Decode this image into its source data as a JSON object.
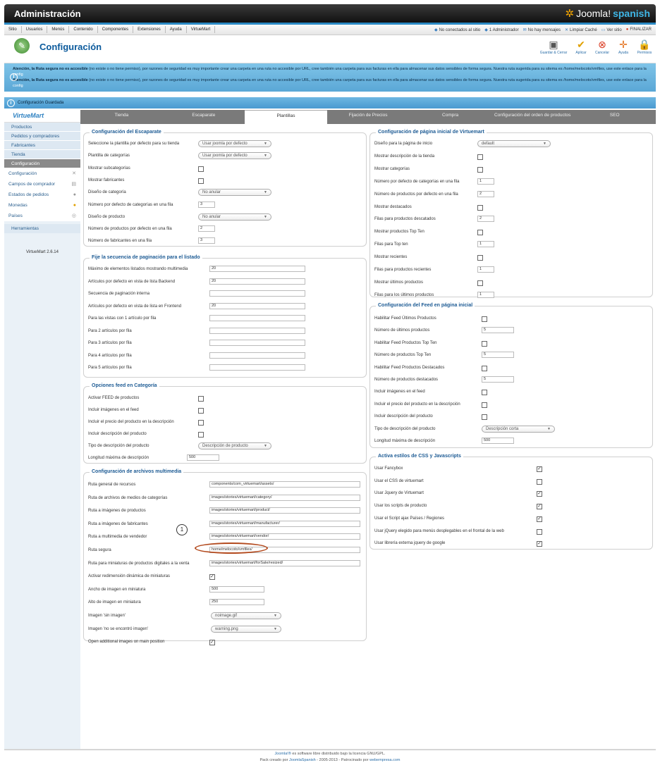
{
  "app": {
    "title": "Administración",
    "logo_word": "Joomla!",
    "logo_suffix": "spanish"
  },
  "menu": {
    "items": [
      "Sitio",
      "Usuarios",
      "Menús",
      "Contenido",
      "Componentes",
      "Extensiones",
      "Ayuda",
      "VirtueMart"
    ],
    "right": [
      "No conectados al sitio",
      "1 Administrador",
      "No hay mensajes",
      "Limpiar Caché",
      "Ver sitio",
      "FINALIZAR"
    ]
  },
  "header": {
    "title": "Configuración"
  },
  "toolbar": {
    "save_close": "Guardar & Cerrar",
    "apply": "Aplicar",
    "cancel": "Cancelar",
    "help": "Ayuda",
    "permissions": "Permisos"
  },
  "alert": {
    "bold_prefix": "Atención, la Ruta segura no ",
    "bold_word": "es accesible",
    "rest": " (no existe o no tiene permiso), por razones de seguridad es muy importante crear una carpeta en una ruta no accesible por URL, cree también una carpeta para sus facturas en ella para almacenar sus datos sensibles de forma segura. Nuestra ruta sugerida para su sitema es /home/melocoto/vmfiles, use este enlace para la ",
    "link": "config"
  },
  "message": {
    "text": "Configuración Guardada"
  },
  "sidebar": {
    "logo": "VirtueMart",
    "items": [
      "Productos",
      "Pedidos y compradores",
      "Fabricantes",
      "Tienda",
      "Configuración"
    ],
    "subitems": [
      "Configuración",
      "Campos de comprador",
      "Estados de pedidos",
      "Monedas",
      "Países"
    ],
    "tools": "Herramientas",
    "version": "VirtueMart 2.6.14"
  },
  "tabs": [
    "Tienda",
    "Escaparate",
    "Plantillas",
    "Fijación de Precios",
    "Compra",
    "Configuración del orden de productos",
    "SEO"
  ],
  "escaparate": {
    "legend": "Configuración del Escaparate",
    "rows": [
      {
        "label": "Seleccione la plantilla por defecto para su tienda",
        "select": "Usar joomla por defecto"
      },
      {
        "label": "Plantilla de categorías",
        "select": "Usar joomla por defecto"
      },
      {
        "label": "Mostrar subcategorías",
        "check": ""
      },
      {
        "label": "Mostrar fabricantes",
        "check": ""
      },
      {
        "label": "Diseño de categoría",
        "select": "No anular"
      },
      {
        "label": "Número por defecto de categorías en una fila",
        "input": "3"
      },
      {
        "label": "Diseño de producto",
        "select": "No anular"
      },
      {
        "label": "Número de productos por defecto en una fila",
        "input": "2"
      },
      {
        "label": "Número de fabricantes en una fila",
        "input": "3"
      }
    ]
  },
  "paginacion": {
    "legend": "Fije la secuencia de paginación para el listado",
    "rows": [
      {
        "label": "Máximo de elementos listados mostrando multimedia",
        "input": "20"
      },
      {
        "label": "Artículos por defecto en vista de lista Backend",
        "input": "20"
      },
      {
        "label": "Secuencia de paginación interna",
        "input": ""
      },
      {
        "label": "Artículos por defecto en vista de lista en Frontend",
        "input": "20"
      },
      {
        "label": "Para las vistas con 1 artículo por fila",
        "input": ""
      },
      {
        "label": "Para 2 artículos por fila",
        "input": ""
      },
      {
        "label": "Para 3 artículos por fila",
        "input": ""
      },
      {
        "label": "Para 4 artículos por fila",
        "input": ""
      },
      {
        "label": "Para 5 artículos por fila",
        "input": ""
      }
    ]
  },
  "feedcat": {
    "legend": "Opciones feed en Categoría",
    "rows": [
      {
        "label": "Activar FEED de productos",
        "check": ""
      },
      {
        "label": "Incluir imágenes en el feed",
        "check": ""
      },
      {
        "label": "Incluir el precio del producto en la descripción",
        "check": ""
      },
      {
        "label": "Incluir descripción del producto",
        "check": ""
      },
      {
        "label": "Tipo de descripción del producto",
        "select": "Descripción de producto"
      },
      {
        "label": "Longitud máxima de descripción",
        "input": "500"
      }
    ]
  },
  "multimedia": {
    "legend": "Configuración de archivos multimedia",
    "rows": [
      {
        "label": "Ruta general de recursos",
        "input": "components/com_virtuemart/assets/"
      },
      {
        "label": "Ruta de archivos de medios de categorías",
        "input": "images/stories/virtuemart/category/"
      },
      {
        "label": "Ruta a imágenes de productos",
        "input": "images/stories/virtuemart/product/"
      },
      {
        "label": "Ruta a imágenes de fabricantes",
        "input": "images/stories/virtuemart/manufacturer/"
      },
      {
        "label": "Ruta a multimedia de vendedor",
        "input": "images/stories/virtuemart/vendor/"
      },
      {
        "label": "Ruta segura",
        "input": "home/melocoto/vmfiles/"
      },
      {
        "label": "Ruta para miniaturas de productos digitales a la venta",
        "input": "images/stories/virtuemart/forSale/resized/"
      },
      {
        "label": "Activar redimensión dinámica de miniaturas",
        "check": "✓"
      },
      {
        "label": "Ancho de imagen en miniatura",
        "input": "500"
      },
      {
        "label": "Alto de imagen en miniatura",
        "input": "250"
      },
      {
        "label": "Imagen 'sin imagen'",
        "select": "noimage.gif"
      },
      {
        "label": "Imagen 'no se encontró imagen'",
        "select": "warning.png"
      },
      {
        "label": "Open additional images on main position",
        "check": "✓"
      }
    ],
    "annotation": "1"
  },
  "inicio": {
    "legend": "Configuración de página inicial de Virtuemart",
    "rows": [
      {
        "label": "Diseño para la página de inicio",
        "select": "default"
      },
      {
        "label": "Mostrar descripción de la tienda",
        "check": ""
      },
      {
        "label": "Mostrar categorías",
        "check": ""
      },
      {
        "label": "Número por defecto de categorías en una fila",
        "input": "1"
      },
      {
        "label": "Número de productos por defecto en una fila",
        "input": "2"
      },
      {
        "label": "Mostrar destacados",
        "check": ""
      },
      {
        "label": "Filas para productos descatados",
        "input": "2"
      },
      {
        "label": "Mostrar productos Top Ten",
        "check": ""
      },
      {
        "label": "Filas para Top ten",
        "input": "1"
      },
      {
        "label": "Mostrar recientes",
        "check": ""
      },
      {
        "label": "Filas para productos recientes",
        "input": "1"
      },
      {
        "label": "Mostrar últimos productos",
        "check": ""
      },
      {
        "label": "Filas para los últimos productos",
        "input": "1"
      }
    ]
  },
  "feedinicio": {
    "legend": "Configuración del Feed en página inicial",
    "rows": [
      {
        "label": "Habilitar Feed Últimos Productos",
        "check": ""
      },
      {
        "label": "Número de últimos productos",
        "input": "5"
      },
      {
        "label": "Habilitar Feed Productos Top Ten",
        "check": ""
      },
      {
        "label": "Número de productos Top Ten",
        "input": "5"
      },
      {
        "label": "Habilitar Feed Productos Destacados",
        "check": ""
      },
      {
        "label": "Número de productos destacados",
        "input": "5"
      },
      {
        "label": "Incluir imágenes en el feed",
        "check": ""
      },
      {
        "label": "Incluir el precio del producto en la descripción",
        "check": ""
      },
      {
        "label": "Incluir descripción del producto",
        "check": ""
      },
      {
        "label": "Tipo de descripción del producto",
        "select": "Descripción corta"
      },
      {
        "label": "Longitud máxima de descripción",
        "input": "500"
      }
    ]
  },
  "css": {
    "legend": "Activa estilos de CSS y Javascripts",
    "rows": [
      {
        "label": "Usar Fancybox",
        "check": "✓"
      },
      {
        "label": "Usar el CSS de virtuemart",
        "check": ""
      },
      {
        "label": "Usar Jquery de Virtuemart",
        "check": "✓"
      },
      {
        "label": "Usar los scripts de producto",
        "check": "✓"
      },
      {
        "label": "Usar el Script ajax Países / Regiones",
        "check": "✓"
      },
      {
        "label": "Usar jQuery elegido para menús desplegables en el frontal de la web",
        "check": ""
      },
      {
        "label": "Usar librería externa jquery de google",
        "check": "✓"
      }
    ]
  },
  "footer": {
    "line1_link": "Joomla!®",
    "line1_rest": " es software libre distribuido bajo la licencia GNU/GPL.",
    "line2_prefix": "Pack creado por ",
    "line2_link1": "JoomlaSpanish",
    "line2_mid": " - 2005-2013 - Patrocinado por ",
    "line2_link2": "webempresa.com"
  }
}
